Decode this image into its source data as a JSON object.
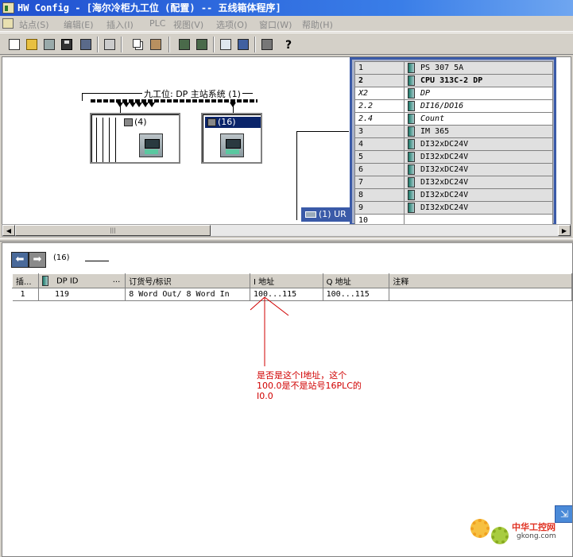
{
  "window": {
    "title": "HW Config - [海尔冷柜九工位 (配置) -- 五线箱体程序]"
  },
  "menu": [
    "站点(S)",
    "编辑(E)",
    "插入(I)",
    "PLC",
    "视图(V)",
    "选项(O)",
    "窗口(W)",
    "帮助(H)"
  ],
  "toolbar": {
    "help_glyph": "?"
  },
  "station": {
    "dp_master_label": "九工位: DP 主站系统 (1)",
    "slaves": [
      {
        "label": "(4)"
      },
      {
        "label": "(16)"
      }
    ],
    "rack_tab_label": "(1) UR",
    "rack_rows": [
      {
        "slot": "1",
        "module": "PS 307 5A",
        "style": "",
        "gray": true
      },
      {
        "slot": "2",
        "module": "CPU 313C-2 DP",
        "style": "b",
        "gray": true
      },
      {
        "slot": "X2",
        "module": "DP",
        "style": "i",
        "gray": false
      },
      {
        "slot": "2.2",
        "module": "DI16/DO16",
        "style": "i",
        "gray": false
      },
      {
        "slot": "2.4",
        "module": "Count",
        "style": "i",
        "gray": false
      },
      {
        "slot": "3",
        "module": "IM 365",
        "style": "",
        "gray": true
      },
      {
        "slot": "4",
        "module": "DI32xDC24V",
        "style": "",
        "gray": true
      },
      {
        "slot": "5",
        "module": "DI32xDC24V",
        "style": "",
        "gray": true
      },
      {
        "slot": "6",
        "module": "DI32xDC24V",
        "style": "",
        "gray": true
      },
      {
        "slot": "7",
        "module": "DI32xDC24V",
        "style": "",
        "gray": true
      },
      {
        "slot": "8",
        "module": "DI32xDC24V",
        "style": "",
        "gray": true
      },
      {
        "slot": "9",
        "module": "DI32xDC24V",
        "style": "",
        "gray": true
      },
      {
        "slot": "10",
        "module": "",
        "style": "",
        "gray": false
      }
    ]
  },
  "detail": {
    "station_label": "(16)",
    "columns": [
      "插...",
      "DP ID",
      "订货号/标识",
      "I 地址",
      "Q 地址",
      "注释"
    ],
    "rows": [
      {
        "slot": "1",
        "dp_id": "119",
        "order": "8 Word Out/ 8 Word In",
        "i_addr": "100...115",
        "q_addr": "100...115",
        "comment": ""
      }
    ]
  },
  "annotation": {
    "lines": [
      "是否是这个I地址，这个",
      "100.0是不是站号16PLC的",
      "I0.0"
    ],
    "color": "#d00000"
  },
  "watermark": {
    "text": "中华工控网",
    "url": "gkong.com"
  }
}
